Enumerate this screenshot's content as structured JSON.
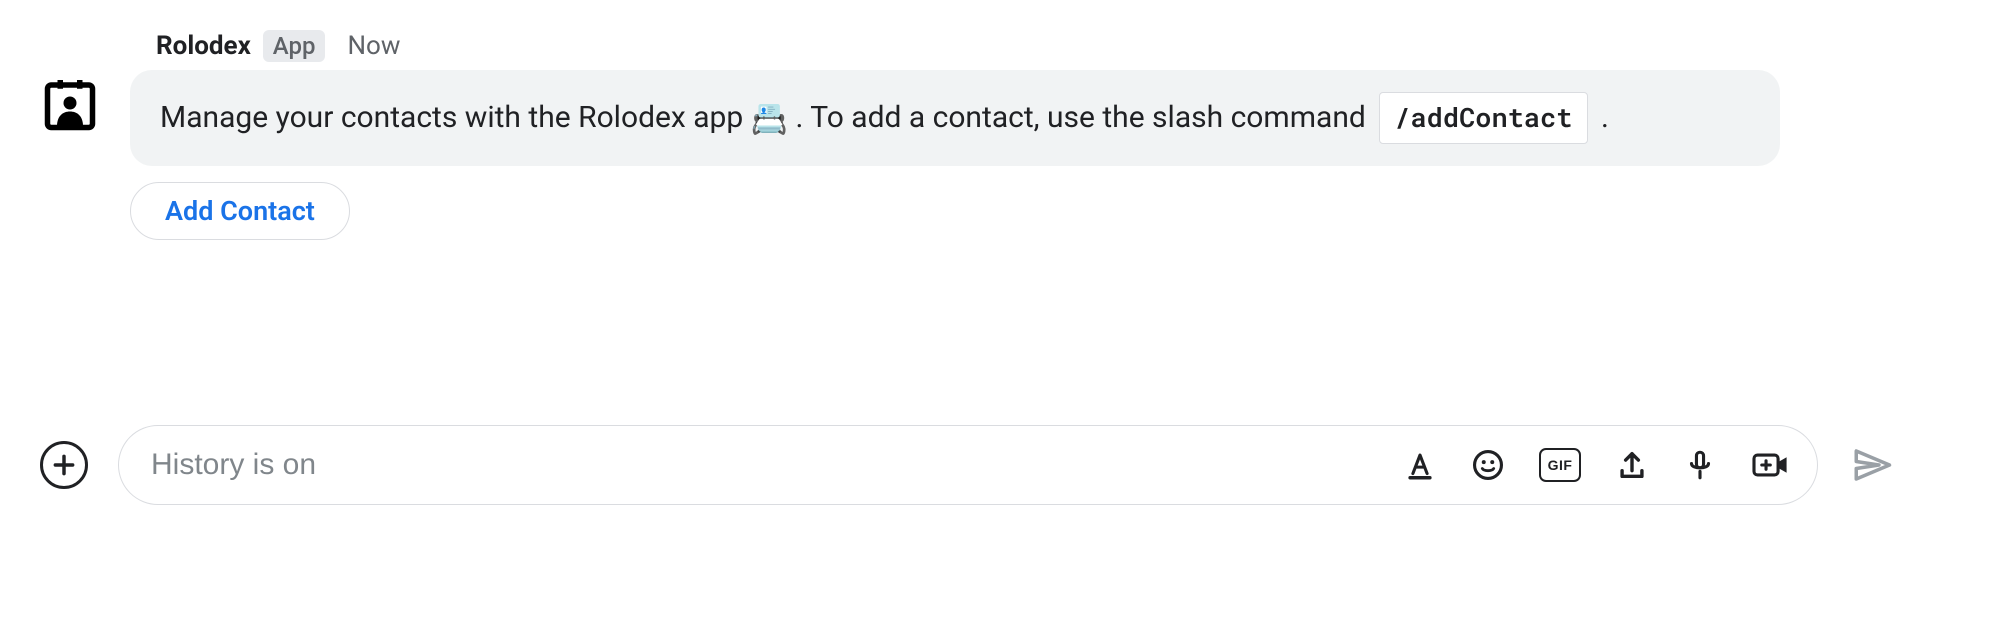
{
  "message": {
    "sender_name": "Rolodex",
    "app_badge": "App",
    "timestamp": "Now",
    "body_part1": "Manage your contacts with the Rolodex app ",
    "emoji": "📇",
    "body_part2": ". To add a contact, use the slash command ",
    "slash_command": "/addContact",
    "body_part3": " .",
    "action_button_label": "Add Contact"
  },
  "composer": {
    "placeholder": "History is on",
    "gif_label": "GIF"
  }
}
